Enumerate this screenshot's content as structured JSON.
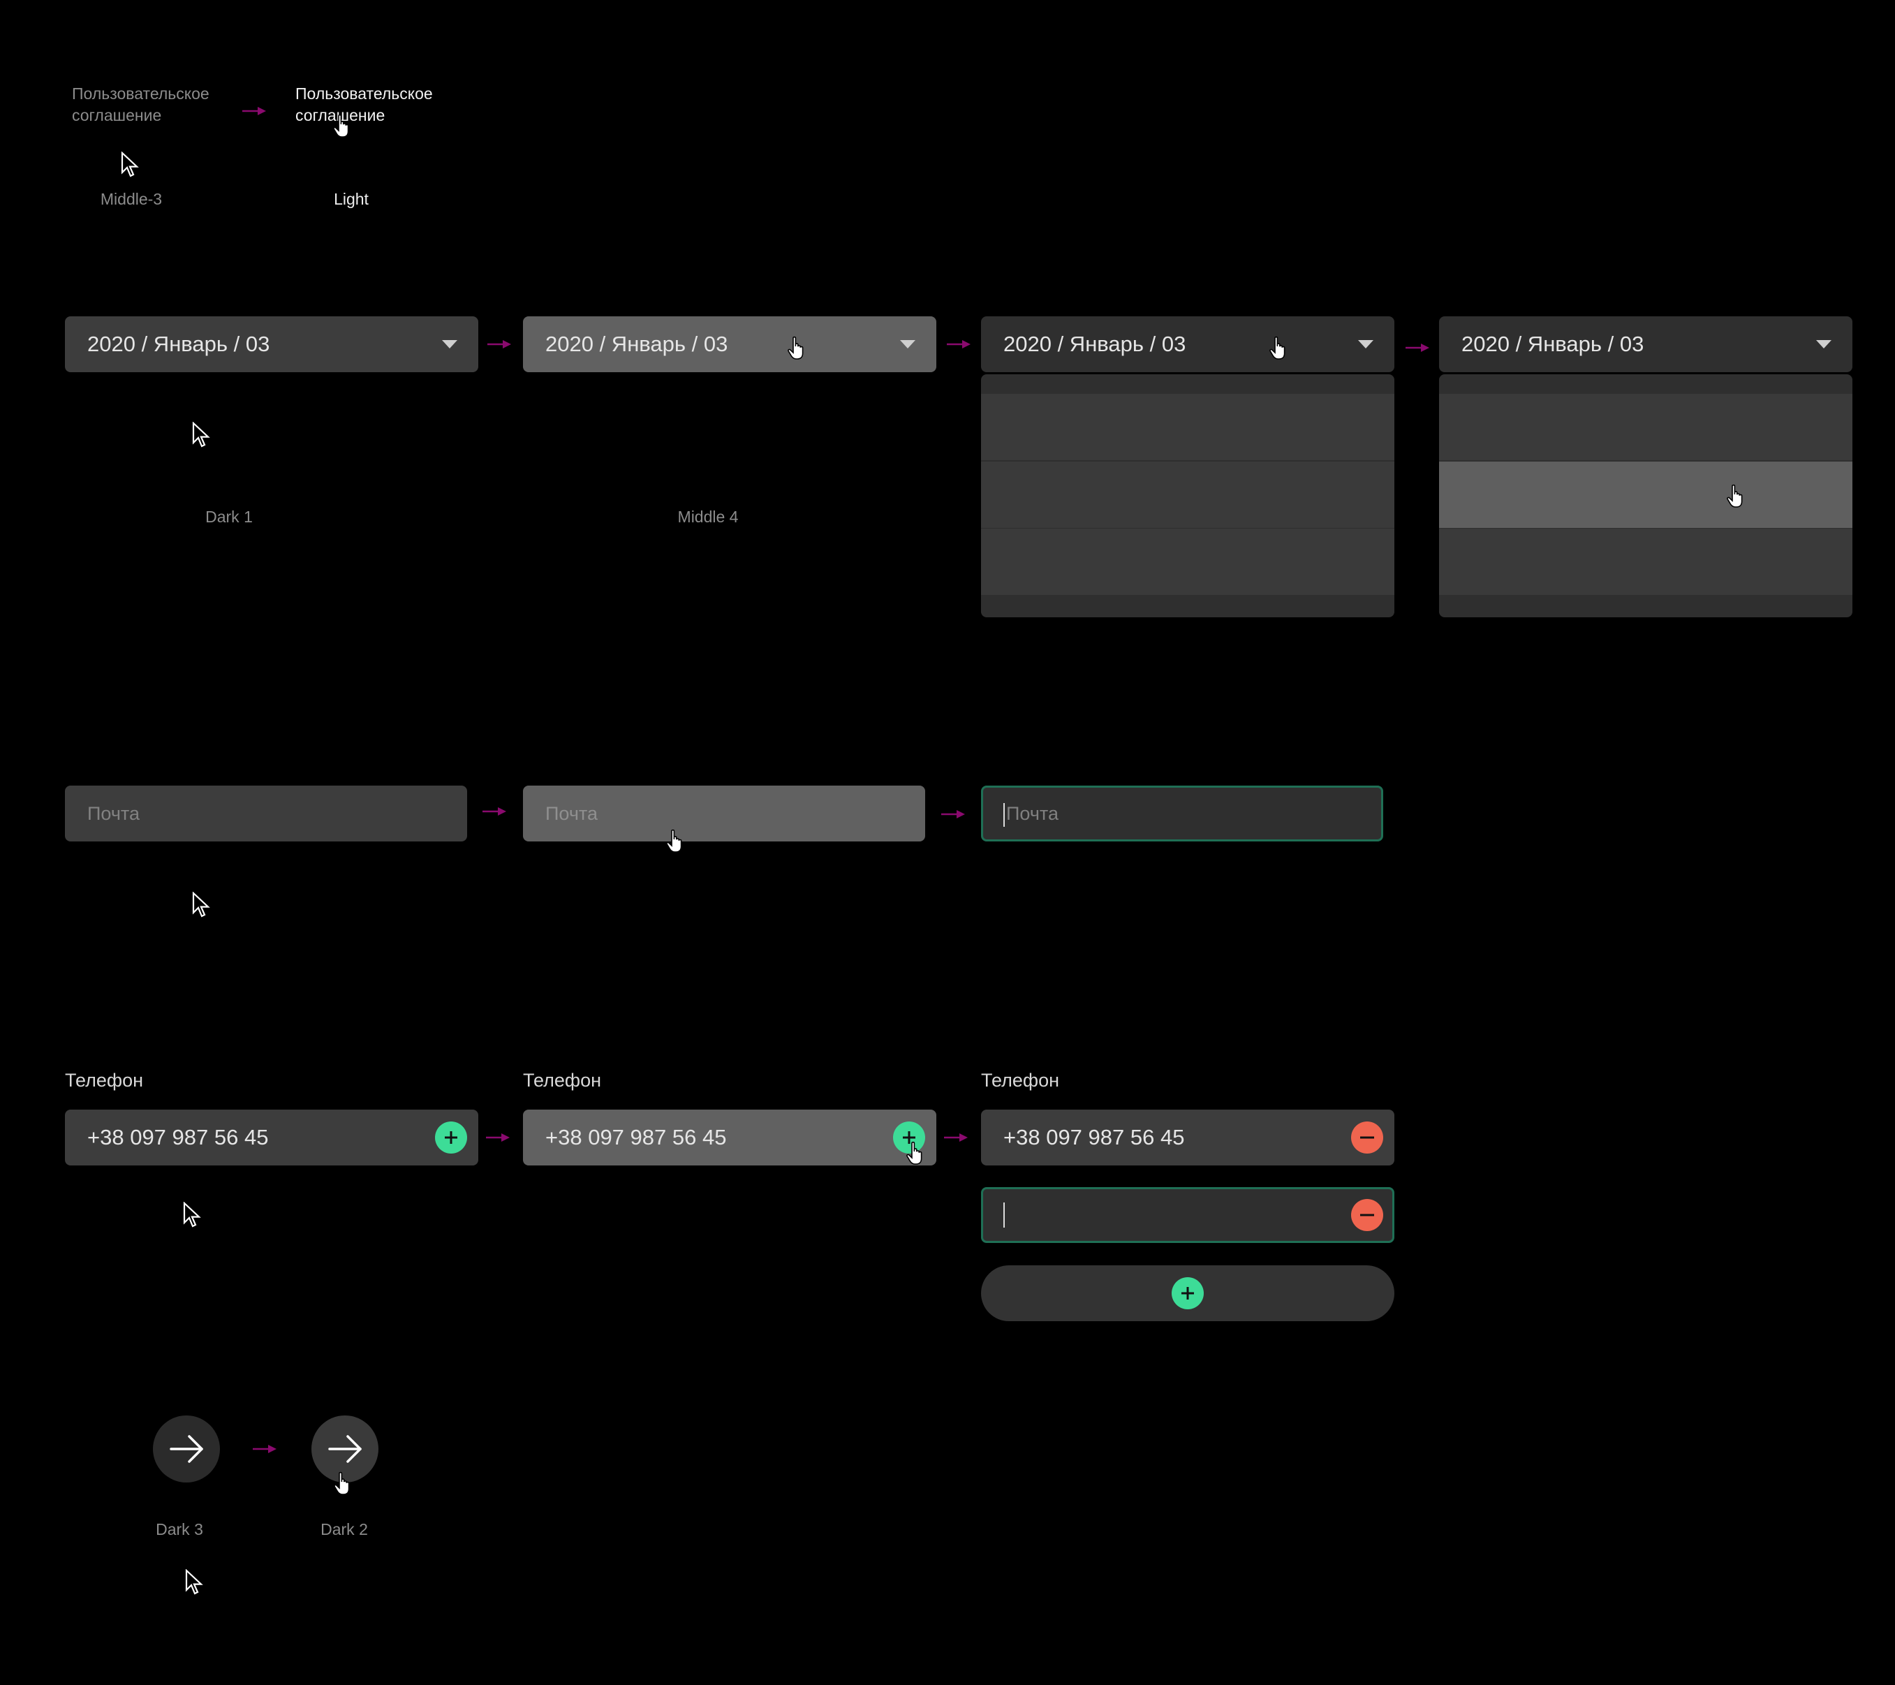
{
  "link": {
    "text_line1": "Пользовательское",
    "text_line2": "соглашение",
    "default_caption": "Middle-3",
    "hover_caption": "Light"
  },
  "dropdown": {
    "value": "2020 / Январь / 03",
    "default_caption": "Dark 1",
    "hover_caption": "Middle 4"
  },
  "email": {
    "placeholder": "Почта"
  },
  "phone": {
    "label": "Телефон",
    "value": "+38 097 987 56 45"
  },
  "next_button": {
    "default_caption": "Dark 3",
    "hover_caption": "Dark 2"
  },
  "colors": {
    "accent_arrow": "#8a0a6e",
    "add_green": "#3ddc97",
    "remove_red": "#f0654f",
    "focus_border": "#1f6f55"
  }
}
